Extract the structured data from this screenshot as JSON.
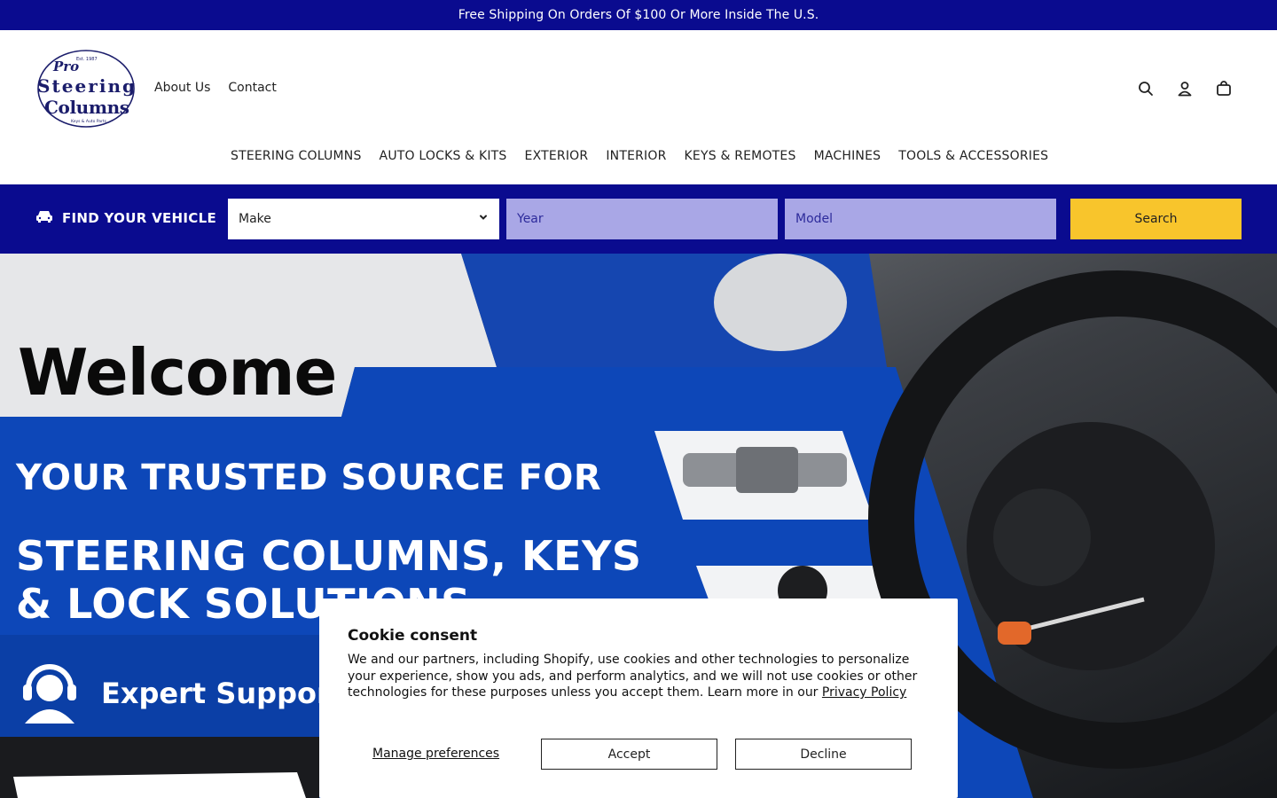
{
  "announcement": {
    "text": "Free Shipping On Orders Of $100 Or More Inside The U.S."
  },
  "logo": {
    "line1": "Pro",
    "line2": "Steering",
    "line3": "Columns",
    "tiny_top": "Est. 1987",
    "tiny_bottom": "Keys & Auto Parts"
  },
  "top_links": [
    {
      "label": "About Us"
    },
    {
      "label": "Contact"
    }
  ],
  "header_icons": [
    "search-icon",
    "account-icon",
    "cart-icon"
  ],
  "main_nav": [
    {
      "label": "STEERING COLUMNS"
    },
    {
      "label": "AUTO LOCKS & KITS"
    },
    {
      "label": "EXTERIOR"
    },
    {
      "label": "INTERIOR"
    },
    {
      "label": "KEYS & REMOTES"
    },
    {
      "label": "MACHINES"
    },
    {
      "label": "TOOLS & ACCESSORIES"
    }
  ],
  "vehicle_finder": {
    "title": "FIND YOUR VEHICLE",
    "make": "Make",
    "year": "Year",
    "model": "Model",
    "search_label": "Search"
  },
  "hero": {
    "welcome": "Welcome",
    "tagline1": "YOUR TRUSTED SOURCE FOR",
    "tagline2_line1": "STEERING COLUMNS, KEYS",
    "tagline2_line2": "& LOCK SOLUTIONS",
    "support": "Expert Support"
  },
  "cookie": {
    "title": "Cookie consent",
    "body": "We and our partners, including Shopify, use cookies and other technologies to personalize your experience, show you ads, and perform analytics, and we will not use cookies or other technologies for these purposes unless you accept them. Learn more in our ",
    "link": "Privacy Policy",
    "manage": "Manage preferences",
    "accept": "Accept",
    "decline": "Decline"
  },
  "colors": {
    "brand_blue": "#0a0b8f",
    "select_lavender": "#a9a7e6",
    "search_yellow": "#f8c52c",
    "hero_blue": "#0d47b8"
  }
}
